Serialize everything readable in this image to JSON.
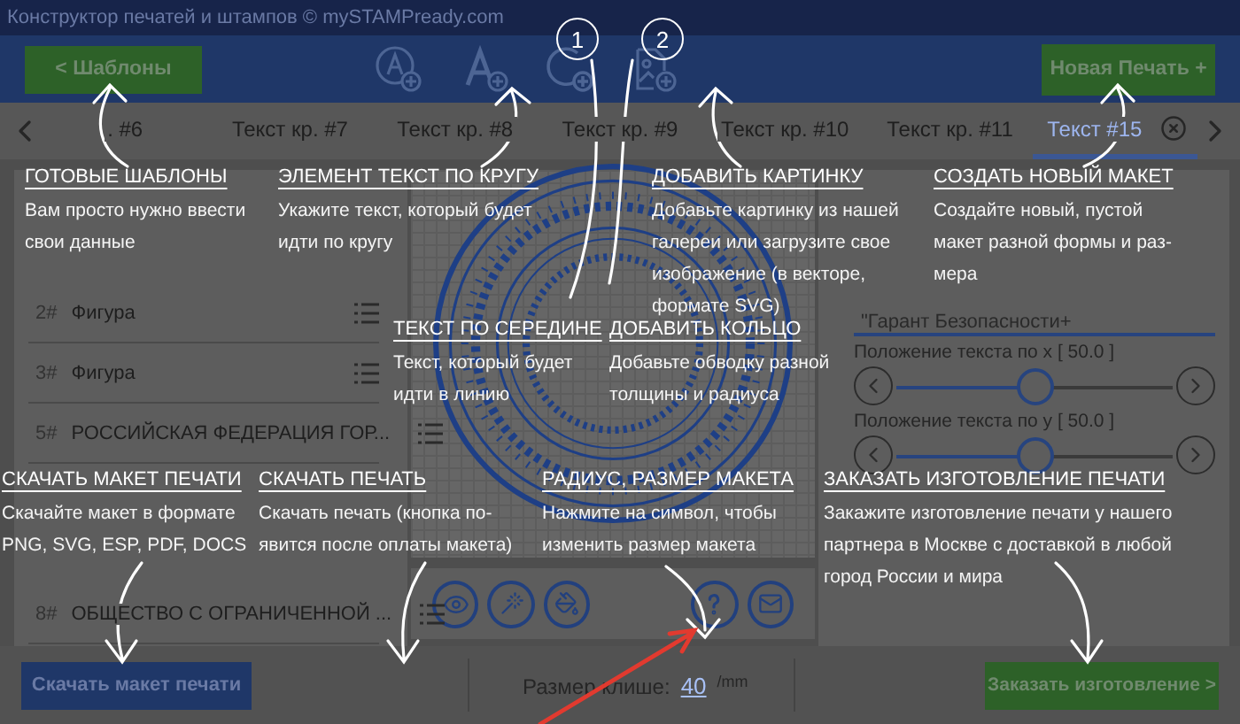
{
  "window": {
    "title": "Конструктор печатей и штампов © mySTAMPready.com"
  },
  "header": {
    "templates_button": "<  Шаблоны",
    "new_button": "Новая Печать +",
    "markers": [
      "1",
      "2"
    ]
  },
  "tabs": [
    {
      "label": ". #6",
      "selected": false
    },
    {
      "label": "Текст кр. #7",
      "selected": false
    },
    {
      "label": "Текст кр. #8",
      "selected": false
    },
    {
      "label": "Текст кр. #9",
      "selected": false
    },
    {
      "label": "Текст кр. #10",
      "selected": false
    },
    {
      "label": "Текст кр. #11",
      "selected": false
    },
    {
      "label": "Текст #15",
      "selected": true
    }
  ],
  "layers": [
    {
      "number": "2#",
      "label": "Фигура"
    },
    {
      "number": "3#",
      "label": "Фигура"
    },
    {
      "number": "5#",
      "label": "РОССИЙСКАЯ ФЕДЕРАЦИЯ ГОР..."
    },
    {
      "number": "8#",
      "label": "ОБЩЕСТВО С ОГРАНИЧЕННОЙ ..."
    }
  ],
  "properties": {
    "text_value": "\"Гарант Безопасности+",
    "sliders": [
      {
        "label": "Положение текста по x [ 50.0 ]",
        "level": 0.5
      },
      {
        "label": "Положение текста по y [ 50.0 ]",
        "level": 0.5
      }
    ]
  },
  "footer": {
    "download_button": "Скачать макет печати",
    "size_label": "Размер клише:",
    "size_value": "40",
    "size_unit": "/mm",
    "order_button": "Заказать изготовление >"
  },
  "tips": [
    {
      "title": "ГОТОВЫЕ ШАБЛОНЫ",
      "text": "Вам просто нужно ввести свои данные"
    },
    {
      "title": "ЭЛЕМЕНТ ТЕКСТ ПО КРУГУ",
      "text": "Укажите текст, который будет идти по кругу"
    },
    {
      "title": "ДОБАВИТЬ КАРТИНКУ",
      "text": "Добавьте картинку из нашей галереи или загрузите свое изображение (в векторе, формате SVG)"
    },
    {
      "title": "СОЗДАТЬ НОВЫЙ МАКЕТ",
      "text": "Создайте новый, пустой макет разной формы и раз-мера"
    },
    {
      "title": "ТЕКСТ ПО СЕРЕДИНЕ",
      "text": "Текст, который будет идти в линию"
    },
    {
      "title": "ДОБАВИТЬ КОЛЬЦО",
      "text": "Добавьте обводку разной толщины и радиуса"
    },
    {
      "title": "СКАЧАТЬ МАКЕТ ПЕЧАТИ",
      "text": "Скачайте макет в формате PNG, SVG, ESP, PDF, DOCS"
    },
    {
      "title": "СКАЧАТЬ ПЕЧАТЬ",
      "text": "Скачать печать (кнопка по-явится после оплаты макета)"
    },
    {
      "title": "РАДИУС, РАЗМЕР МАКЕТА",
      "text": "Нажмите на символ, чтобы изменить размер макета"
    },
    {
      "title": "ЗАКАЗАТЬ ИЗГОТОВЛЕНИЕ ПЕЧАТИ",
      "text": "Закажите изготовление печати у нашего партнера в Москве с доставкой в любой город России и мира"
    }
  ]
}
